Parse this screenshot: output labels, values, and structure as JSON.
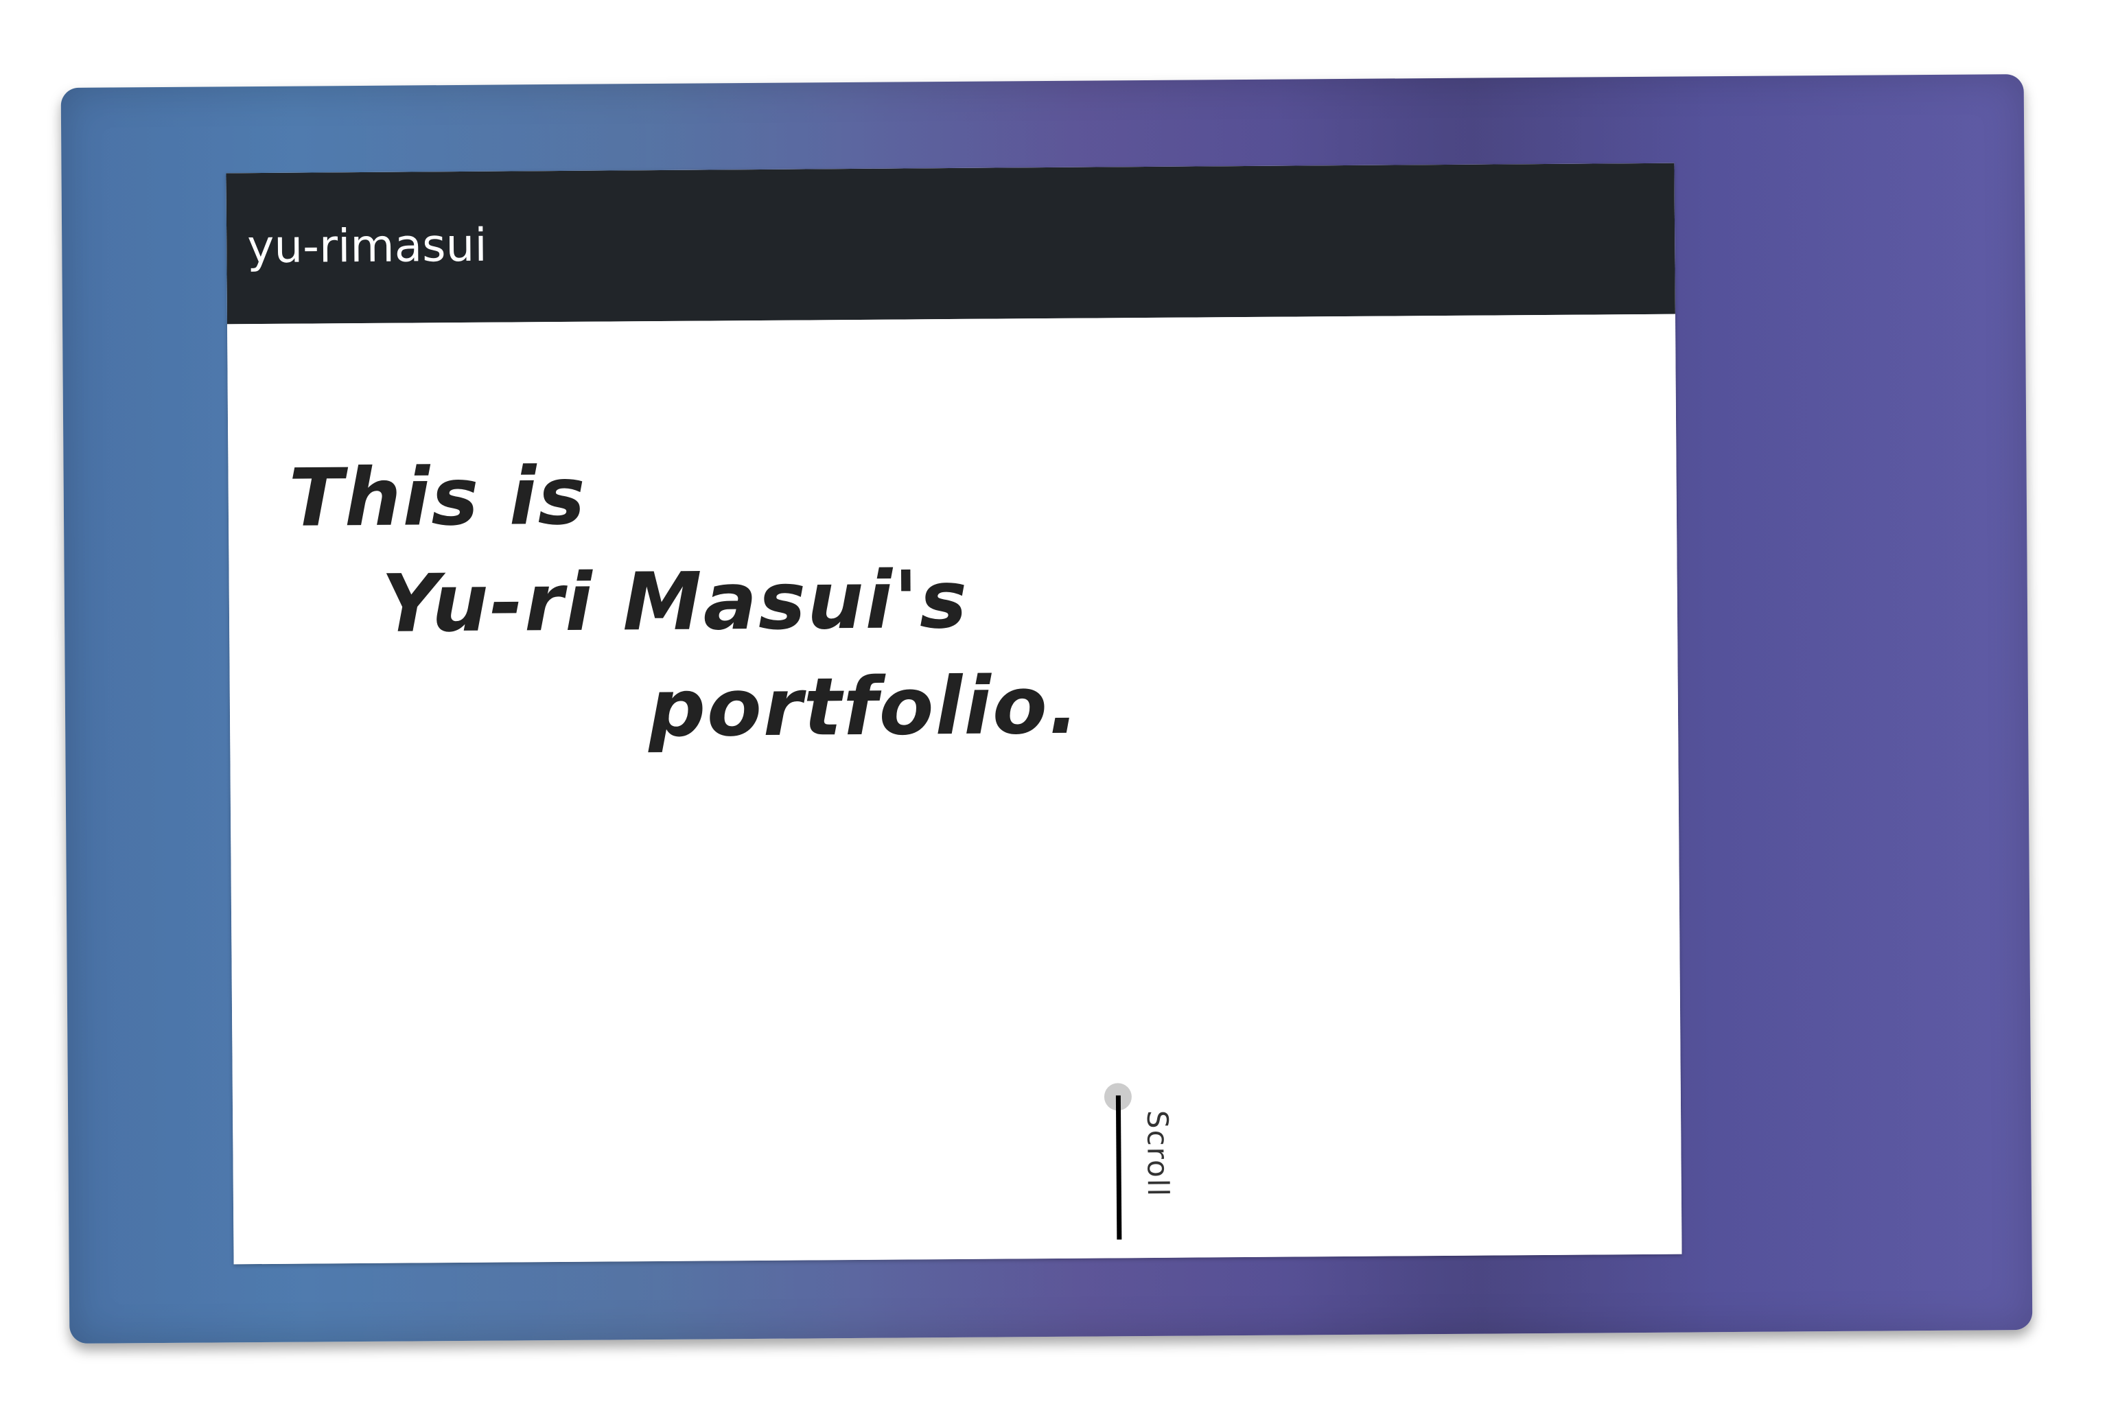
{
  "navbar": {
    "brand": "yu-rimasui"
  },
  "hero": {
    "line1": "This is",
    "line2": "Yu-ri Masui's",
    "line3": "portfolio."
  },
  "scroll": {
    "label": "Scroll"
  },
  "colors": {
    "navbar_bg": "#212529",
    "frame_gradient_start": "#4a72a6",
    "frame_gradient_end": "#5a56a2",
    "text": "#222222"
  }
}
